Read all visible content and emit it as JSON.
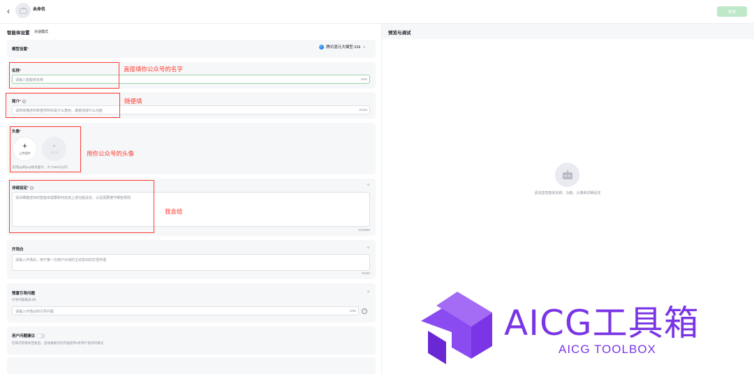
{
  "topbar": {
    "back_glyph": "‹",
    "bot_name": "未命名",
    "publish_label": "发布"
  },
  "config": {
    "title": "智能体设置",
    "subtitle": "对话模式"
  },
  "model": {
    "label": "模型设置",
    "required": "*",
    "selected": "腾讯混元大模型-32k",
    "chevron": "⌄"
  },
  "name_field": {
    "label": "名称",
    "required": "*",
    "placeholder": "请输入智能体名称",
    "counter": "0/30"
  },
  "intro_field": {
    "label": "简介",
    "required": "*",
    "placeholder": "请简单描述你希望你所的是什么角色、或者完成什么功能",
    "counter": "0/150"
  },
  "avatar": {
    "label": "头像",
    "required": "*",
    "upload_label": "上传图片",
    "ai_label": "AI生成",
    "hint": "支持jpg和png格式图片，大小5M以以内"
  },
  "detail_setting": {
    "label": "详细设定",
    "required": "*",
    "placeholder": "请详细描述你的智能体需要和何完成上述功能设定，以及需要遵守哪些规则",
    "counter": "0/10000"
  },
  "opening": {
    "label": "开场白",
    "placeholder": "请输入开场白，用于第一次用户对话时主动发出的打招呼语",
    "counter": "0/150"
  },
  "preset_questions": {
    "label": "预置引导问题",
    "hint": "引导问题最多3条",
    "placeholder": "请输入开场白的引导问题",
    "counter": "0/30"
  },
  "user_suggest": {
    "label": "用户问题建议",
    "hint": "在每次智能体回复后，自动根据对话内容提供3条用户提问的建议"
  },
  "preview": {
    "title": "预览与调试",
    "placeholder": "请完善智能体名称、功能、头像和详细设定"
  },
  "annotations": {
    "name_note": "直接填你公众号的名字",
    "intro_note": "随便填",
    "avatar_note": "用你公众号的头像",
    "detail_note": "我会给"
  },
  "watermark": {
    "title": "AICG工具箱",
    "subtitle": "AICG TOOLBOX"
  },
  "colors": {
    "accent_green": "#bfe8c9",
    "annotation_red": "#ff3b30",
    "brand_purple": "#7a35e6",
    "panel_bg": "#f6f7f9"
  },
  "icons": [
    "back-icon",
    "bot-avatar-icon",
    "model-icon",
    "info-icon",
    "plus-icon",
    "ai-sparkle-icon",
    "optimize-icon",
    "remove-icon",
    "toggle-switch",
    "robot-placeholder-icon",
    "brand-logo-icon"
  ]
}
